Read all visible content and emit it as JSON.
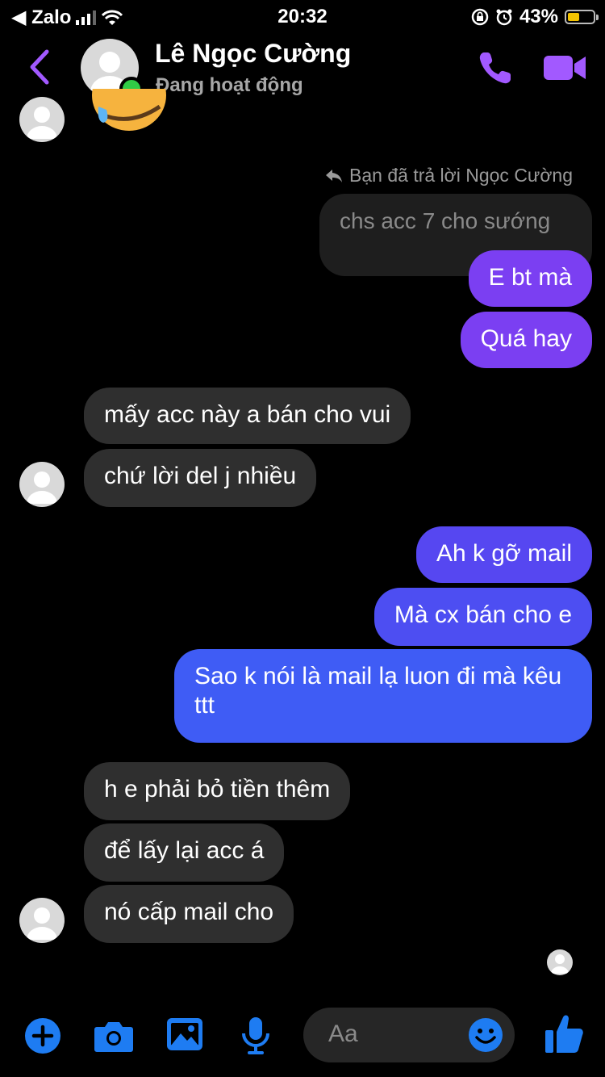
{
  "status_bar": {
    "back_app": "◀ Zalo",
    "time": "20:32",
    "battery": "43%",
    "battery_level": 0.43
  },
  "header": {
    "name": "Lê Ngọc Cường",
    "status": "Đang hoạt động",
    "online": true
  },
  "thread": {
    "reply_indicator": "Bạn đã trả lời Ngọc Cường",
    "quoted_message": "chs acc 7 cho sướng",
    "messages": [
      {
        "from": "me",
        "text": "E bt mà",
        "color": "#7b3ff2"
      },
      {
        "from": "me",
        "text": "Quá hay",
        "color": "#7b3ff2"
      },
      {
        "from": "them",
        "text": "mấy acc này a bán cho vui"
      },
      {
        "from": "them",
        "text": "chứ lời del j nhiều"
      },
      {
        "from": "me",
        "text": "Ah k gỡ mail",
        "color": "#5647f1"
      },
      {
        "from": "me",
        "text": "Mà cx bán cho e",
        "color": "#4d4ef2"
      },
      {
        "from": "me",
        "text": "Sao k nói là mail lạ luon đi mà kêu ttt",
        "color": "#3f5cf5"
      },
      {
        "from": "them",
        "text": "h e phải bỏ tiền thêm"
      },
      {
        "from": "them",
        "text": "để lấy lại acc á"
      },
      {
        "from": "them",
        "text": "nó cấp mail cho"
      }
    ]
  },
  "composer": {
    "placeholder": "Aa",
    "icons": [
      "add-icon",
      "camera-icon",
      "image-icon",
      "microphone-icon",
      "emoji-icon",
      "like-icon"
    ]
  },
  "colors": {
    "accent": "#a259ff",
    "composer_icons": "#1e7cf2",
    "incoming_bubble": "#2f2f2f"
  }
}
